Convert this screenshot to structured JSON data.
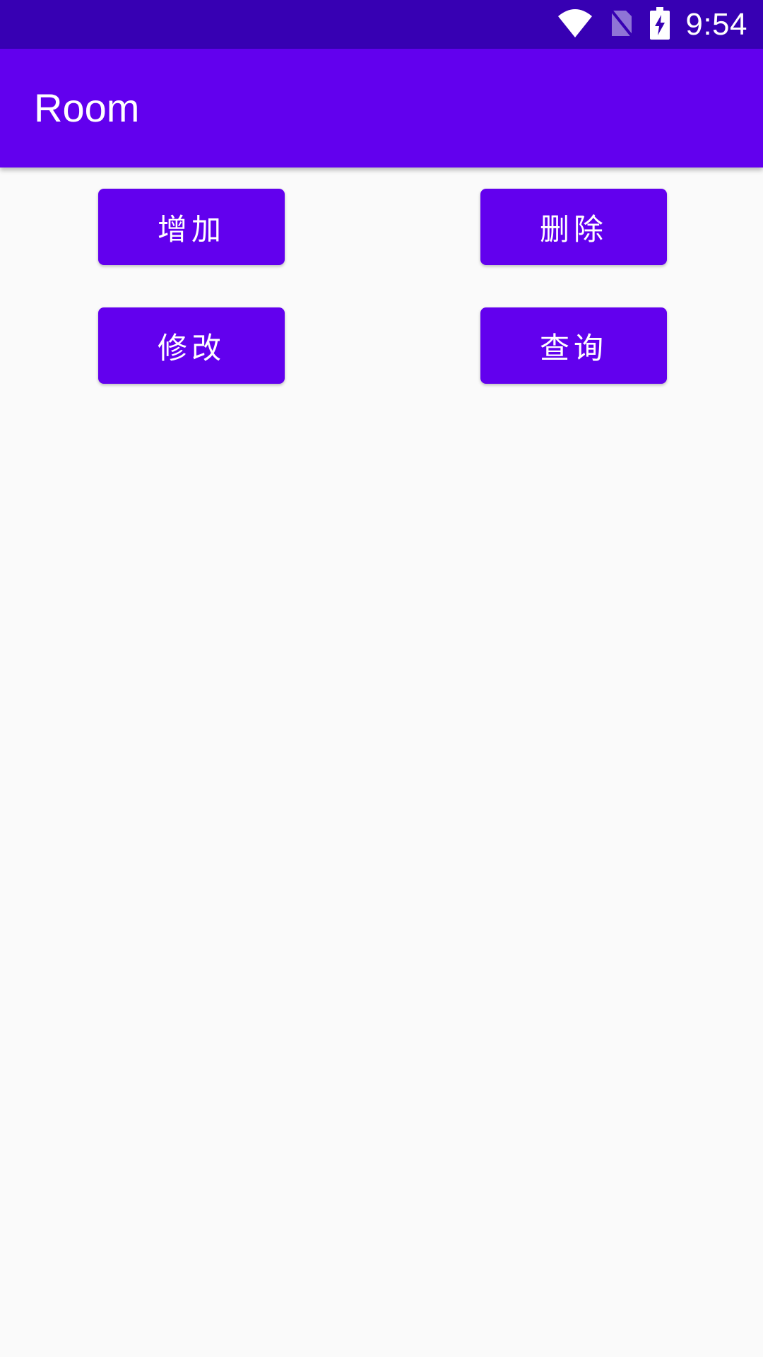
{
  "status_bar": {
    "time": "9:54",
    "icons": [
      "wifi-icon",
      "no-sim-icon",
      "battery-charging-icon"
    ],
    "background": "#3700b3"
  },
  "app_bar": {
    "title": "Room",
    "background": "#6200ee"
  },
  "buttons": {
    "add_label": "增加",
    "delete_label": "删除",
    "update_label": "修改",
    "query_label": "查询",
    "color": "#6200ee"
  }
}
